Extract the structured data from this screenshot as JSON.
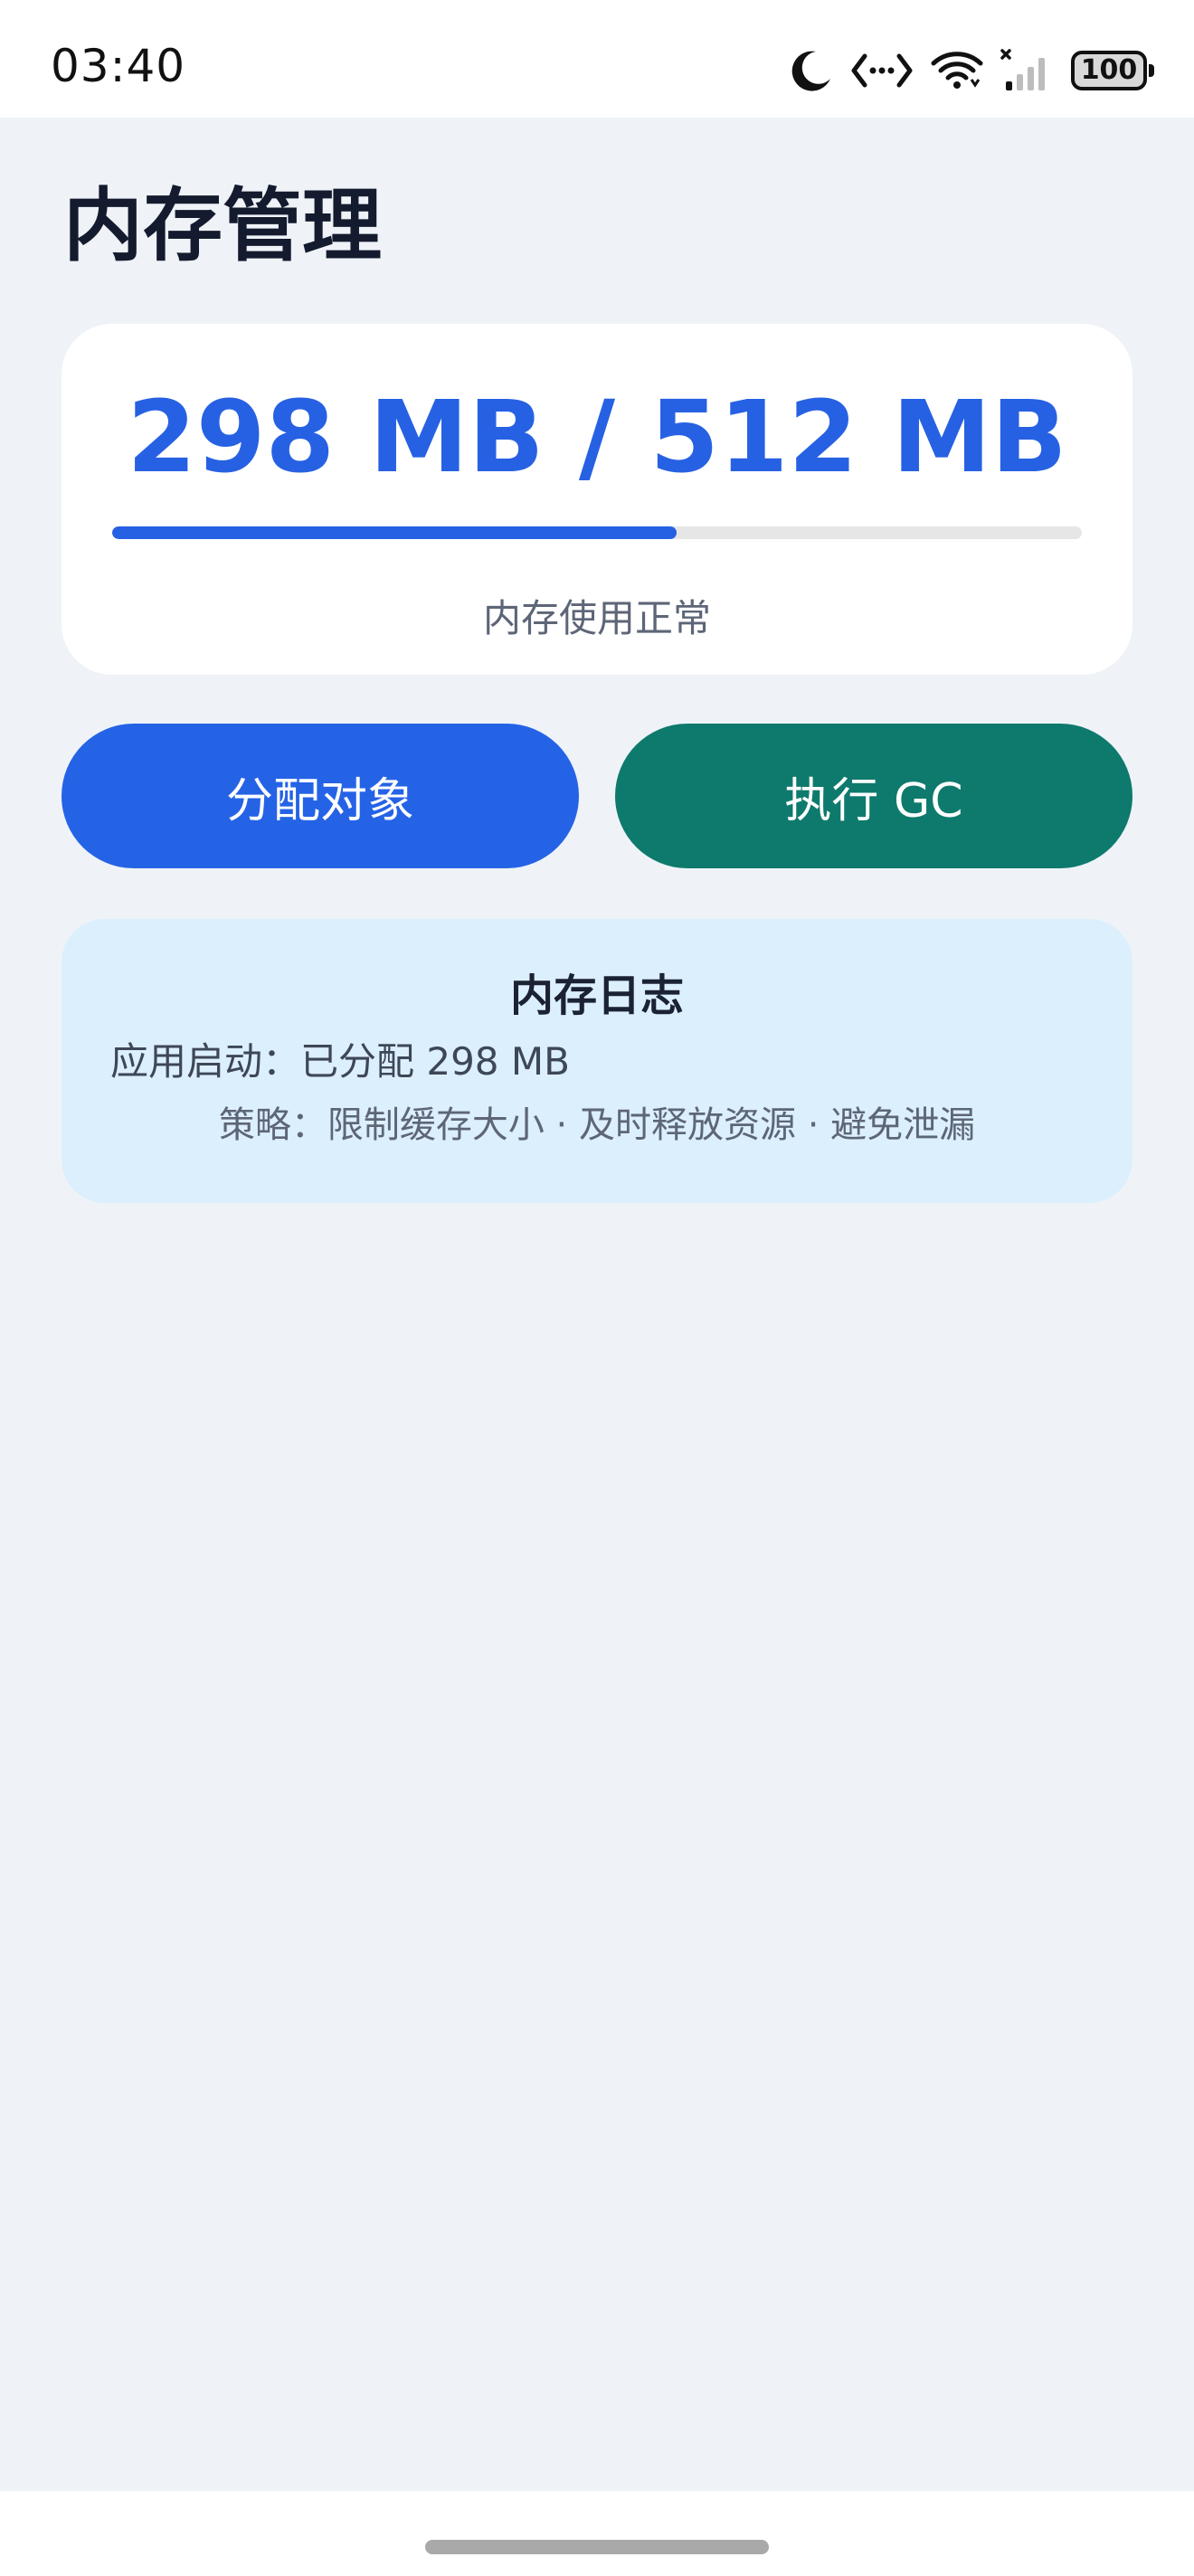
{
  "status_bar": {
    "time": "03:40",
    "battery": "100",
    "icons": [
      "moon-icon",
      "data-transfer-icon",
      "wifi-icon",
      "signal-icon",
      "battery-icon"
    ]
  },
  "page": {
    "title": "内存管理"
  },
  "usage": {
    "value": "298 MB / 512 MB",
    "used_mb": 298,
    "total_mb": 512,
    "status": "内存使用正常",
    "accent_color": "#2761E3"
  },
  "actions": {
    "allocate_label": "分配对象",
    "gc_label": "执行 GC",
    "allocate_color": "#2563E6",
    "gc_color": "#0E7A6D"
  },
  "log": {
    "title": "内存日志",
    "entry": "应用启动：已分配 298 MB",
    "strategy": "策略：限制缓存大小 · 及时释放资源 · 避免泄漏"
  }
}
